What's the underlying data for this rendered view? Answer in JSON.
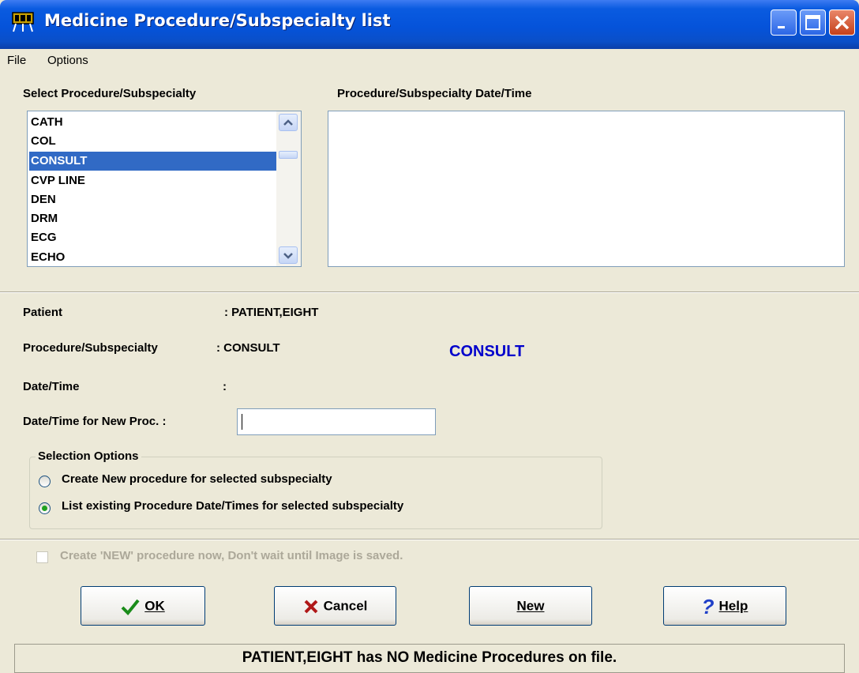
{
  "window": {
    "title": "Medicine Procedure/Subspecialty list"
  },
  "menu": {
    "items": [
      "File",
      "Options"
    ]
  },
  "procedure_list": {
    "label": "Select Procedure/Subspecialty",
    "items": [
      "CATH",
      "COL",
      "CONSULT",
      "CVP LINE",
      "DEN",
      "DRM",
      "ECG",
      "ECHO"
    ],
    "selected": "CONSULT"
  },
  "datetime_list": {
    "label": "Procedure/Subspecialty Date/Time"
  },
  "details": {
    "patient_label": "Patient",
    "patient_value": ": PATIENT,EIGHT",
    "procedure_label": "Procedure/Subspecialty",
    "procedure_value": ": CONSULT",
    "procedure_highlight": "CONSULT",
    "datetime_label": "Date/Time",
    "datetime_value": ":",
    "newproc_label": "Date/Time for New Proc.  :",
    "newproc_value": ""
  },
  "selection_options": {
    "title": "Selection Options",
    "option_create": "Create New procedure for selected subspecialty",
    "option_list": "List existing Procedure Date/Times for selected subspecialty",
    "selected": "list"
  },
  "create_now_checkbox": {
    "label": "Create 'NEW' procedure now, Don't wait until Image is saved.",
    "checked": false,
    "enabled": false
  },
  "buttons": {
    "ok": "OK",
    "cancel": "Cancel",
    "new": "New",
    "help": "Help"
  },
  "status": {
    "message": "PATIENT,EIGHT has NO Medicine Procedures on file."
  },
  "colors": {
    "selection": "#316AC5",
    "highlight_text": "#0000CC",
    "title_bar": "#0553DA"
  }
}
